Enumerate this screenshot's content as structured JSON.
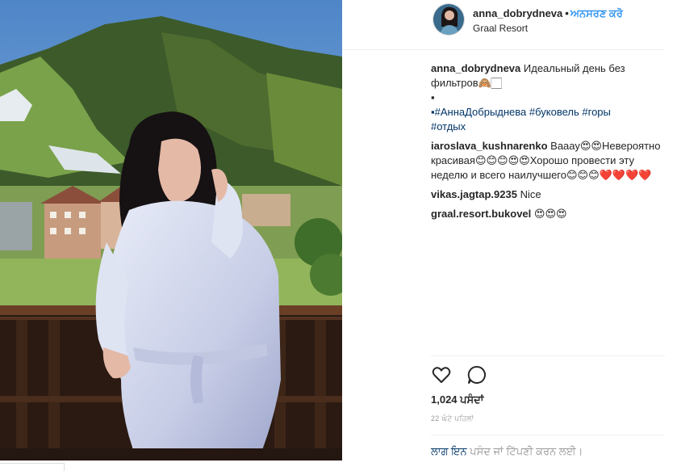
{
  "post": {
    "username": "anna_dobrydneva",
    "dot": "•",
    "follow_label": "ਅਨਸਰਣ ਕਰੋ",
    "location": "Graal Resort"
  },
  "caption": {
    "username": "anna_dobrydneva",
    "text_line1": "Идеальный день без",
    "text_line2": "фильтров🙈🏻",
    "dot_line": "▪",
    "tags_line1": "▪#АннаДобрыднева #буковель #горы",
    "tags_line2": "#отдых"
  },
  "comments": [
    {
      "username": "iaroslava_kushnarenko",
      "text": "Вааау😍😍Невероятно красивая😊😊😊😍😍Хорошо провести эту неделю и всего наилучшего😊😊😊❤️❤️❤️❤️"
    },
    {
      "username": "vikas.jagtap.9235",
      "text": "Nice"
    },
    {
      "username": "graal.resort.bukovel",
      "text": "😍😍😍"
    }
  ],
  "actions": {
    "like_icon": "heart-icon",
    "comment_icon": "comment-icon"
  },
  "likes_text": "1,024 ਪਸੰਦਾਂ",
  "timestamp": "22 ਘੰਟੇ ਪਹਿਲਾਂ",
  "login": {
    "link_text": "ਲਾਗ ਇਨ",
    "rest_text": " ਪਸੰਦ ਜਾਂ ਟਿੱਪਣੀ ਕਰਨ ਲਈ।"
  },
  "colors": {
    "link_blue": "#3897f0",
    "tag_blue": "#003569",
    "muted": "#999999"
  }
}
